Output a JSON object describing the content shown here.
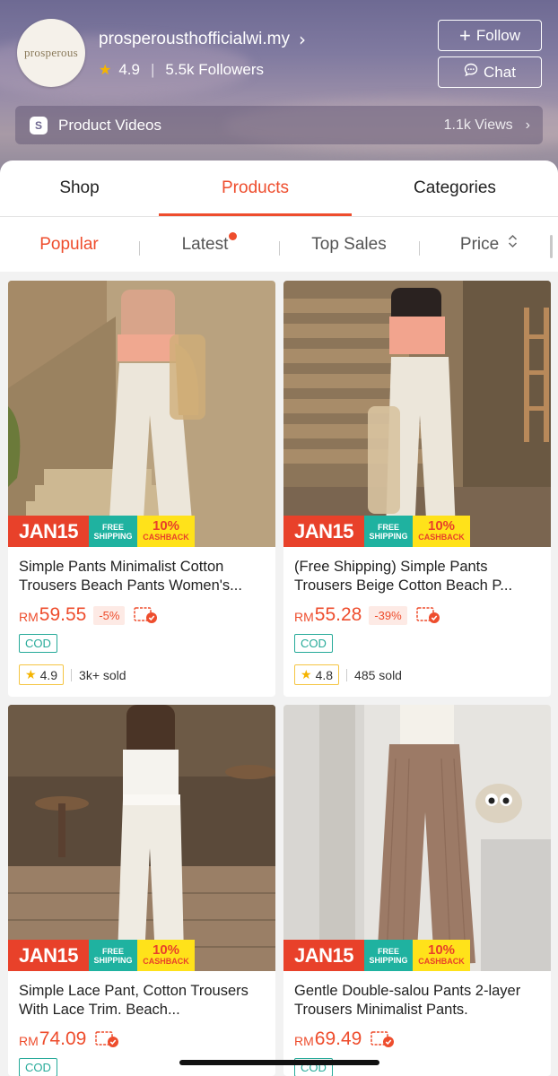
{
  "shop": {
    "logo_text": "prosperous",
    "name": "prosperousthofficialwi.my",
    "rating": "4.9",
    "followers": "5.5k Followers",
    "follow_label": "Follow",
    "chat_label": "Chat"
  },
  "videos": {
    "label": "Product Videos",
    "views": "1.1k Views"
  },
  "tabs": [
    {
      "label": "Shop",
      "active": false
    },
    {
      "label": "Products",
      "active": true
    },
    {
      "label": "Categories",
      "active": false
    }
  ],
  "sort": [
    {
      "label": "Popular",
      "active": true
    },
    {
      "label": "Latest",
      "active": false,
      "has_dot": true
    },
    {
      "label": "Top Sales",
      "active": false
    },
    {
      "label": "Price",
      "active": false
    }
  ],
  "banner": {
    "date": "JAN15",
    "free_line1": "FREE",
    "free_line2": "SHIPPING",
    "cashback_pct": "10%",
    "cashback_label": "CASHBACK"
  },
  "products": [
    {
      "title": "Simple Pants Minimalist Cotton Trousers Beach Pants Women's...",
      "currency": "RM",
      "price": "59.55",
      "discount": "-5%",
      "cod": "COD",
      "rating": "4.9",
      "sold": "3k+ sold"
    },
    {
      "title": "(Free Shipping) Simple Pants Trousers Beige Cotton Beach P...",
      "currency": "RM",
      "price": "55.28",
      "discount": "-39%",
      "cod": "COD",
      "rating": "4.8",
      "sold": "485 sold"
    },
    {
      "title": "Simple Lace Pant, Cotton Trousers With Lace Trim. Beach...",
      "currency": "RM",
      "price": "74.09",
      "discount": "",
      "cod": "COD",
      "rating": "",
      "sold": ""
    },
    {
      "title": "Gentle Double-salou Pants 2-layer Trousers Minimalist Pants.",
      "currency": "RM",
      "price": "69.49",
      "discount": "",
      "cod": "COD",
      "rating": "",
      "sold": ""
    }
  ],
  "colors": {
    "accent": "#ee4d2d",
    "cod": "#26aa99",
    "jan_banner": "#e8412a",
    "shipping_banner": "#1fb2a0",
    "cashback_banner": "#ffe21a"
  }
}
